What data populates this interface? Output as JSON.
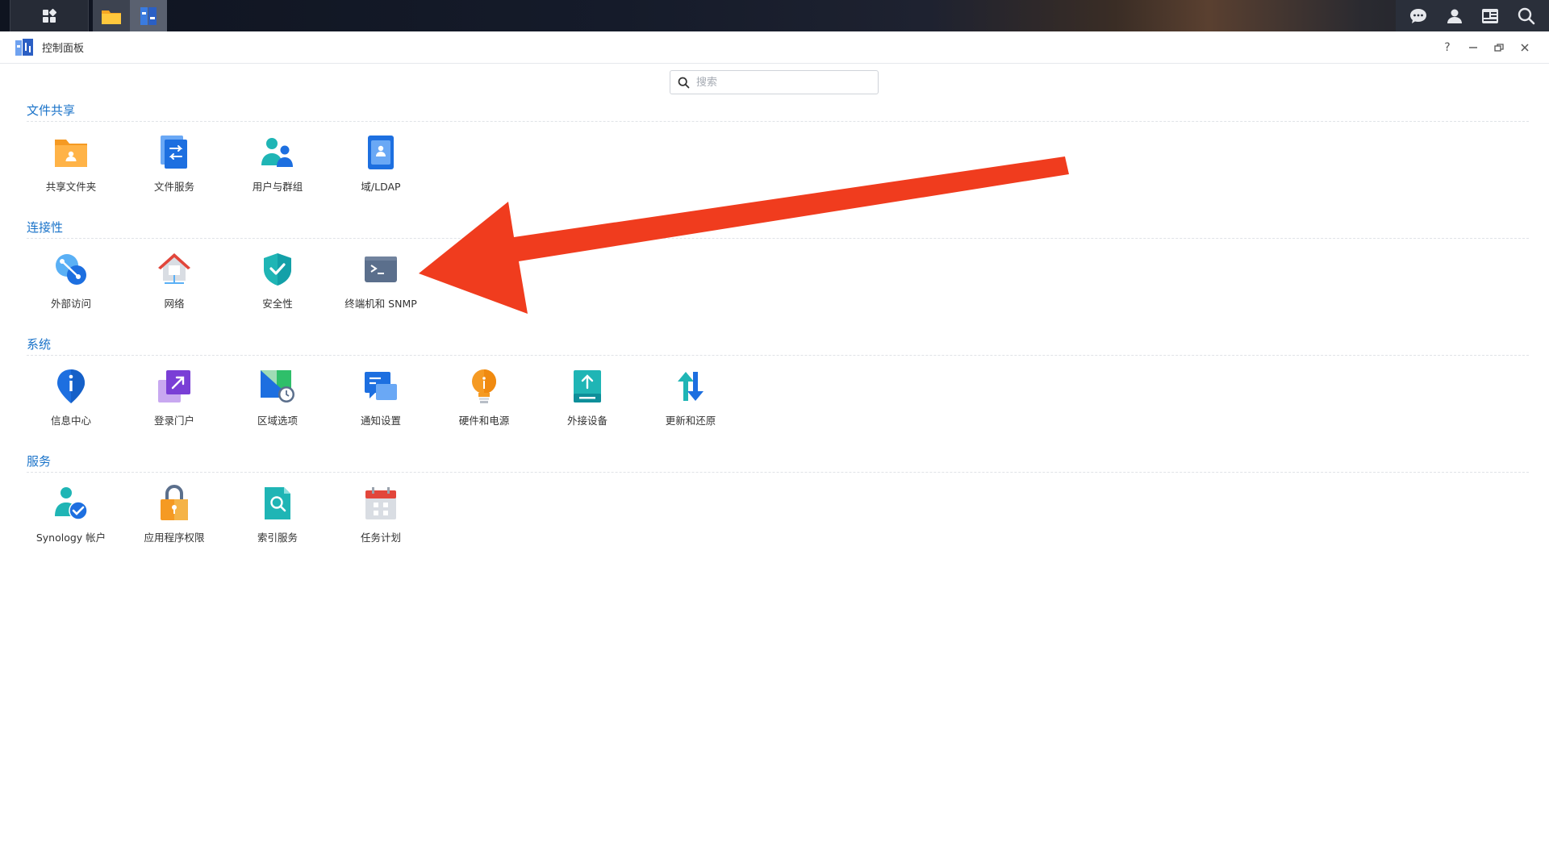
{
  "window": {
    "title": "控制面板"
  },
  "search": {
    "placeholder": "搜索"
  },
  "sections": [
    {
      "title": "文件共享",
      "items": [
        {
          "label": "共享文件夹",
          "icon": "shared-folder-icon"
        },
        {
          "label": "文件服务",
          "icon": "file-services-icon"
        },
        {
          "label": "用户与群组",
          "icon": "user-group-icon"
        },
        {
          "label": "域/LDAP",
          "icon": "domain-ldap-icon"
        }
      ]
    },
    {
      "title": "连接性",
      "items": [
        {
          "label": "外部访问",
          "icon": "external-access-icon"
        },
        {
          "label": "网络",
          "icon": "network-icon"
        },
        {
          "label": "安全性",
          "icon": "security-icon"
        },
        {
          "label": "终端机和 SNMP",
          "icon": "terminal-snmp-icon"
        }
      ]
    },
    {
      "title": "系统",
      "items": [
        {
          "label": "信息中心",
          "icon": "info-center-icon"
        },
        {
          "label": "登录门户",
          "icon": "login-portal-icon"
        },
        {
          "label": "区域选项",
          "icon": "regional-options-icon"
        },
        {
          "label": "通知设置",
          "icon": "notification-icon"
        },
        {
          "label": "硬件和电源",
          "icon": "hardware-power-icon"
        },
        {
          "label": "外接设备",
          "icon": "external-devices-icon"
        },
        {
          "label": "更新和还原",
          "icon": "update-restore-icon"
        }
      ]
    },
    {
      "title": "服务",
      "items": [
        {
          "label": "Synology 帐户",
          "icon": "synology-account-icon"
        },
        {
          "label": "应用程序权限",
          "icon": "app-privileges-icon"
        },
        {
          "label": "索引服务",
          "icon": "indexing-service-icon"
        },
        {
          "label": "任务计划",
          "icon": "task-scheduler-icon"
        }
      ]
    }
  ],
  "colors": {
    "section_title": "#1a73c9",
    "arrow": "#f03c1e"
  }
}
